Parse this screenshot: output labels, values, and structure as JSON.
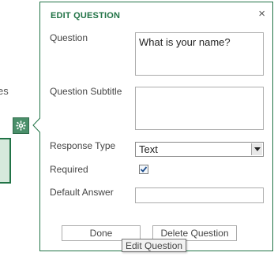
{
  "background": {
    "partial_text": "es"
  },
  "panel": {
    "title": "EDIT QUESTION",
    "close_symbol": "×",
    "question_label": "Question",
    "question_value": "What is your name?",
    "subtitle_label": "Question Subtitle",
    "subtitle_value": "",
    "response_type_label": "Response Type",
    "response_type_value": "Text",
    "required_label": "Required",
    "required_checked": true,
    "default_answer_label": "Default Answer",
    "default_answer_value": "",
    "done_label": "Done",
    "delete_label": "Delete Question"
  },
  "tooltip": {
    "text": "Edit Question"
  },
  "colors": {
    "accent": "#217346",
    "gear_button": "#4a8f6a",
    "selection_fill": "#d6e9dc"
  },
  "icons": {
    "gear": "gear-icon",
    "close": "close-icon",
    "dropdown": "chevron-down-icon",
    "check": "checkmark-icon"
  }
}
